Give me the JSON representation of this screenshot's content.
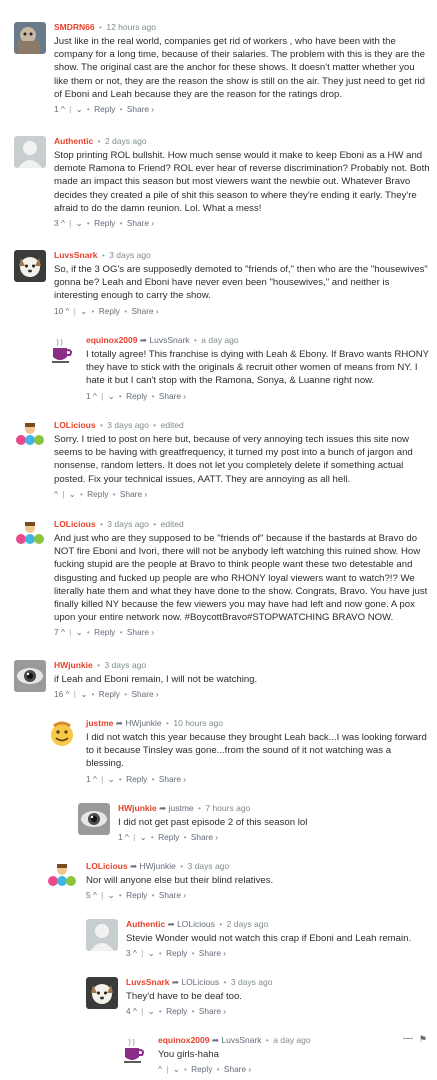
{
  "actions": {
    "reply": "Reply",
    "share": "Share ›",
    "upvote": "^",
    "downvote": "⌄",
    "sep": "|",
    "dot": "•",
    "reply_arrow": "➦",
    "collapse": "—",
    "flag": "⚑"
  },
  "comments": [
    {
      "author": "SMDRN66",
      "meta": "12 hours ago",
      "text": "Just like in the real world, companies get rid of workers , who have been with the company for a long time, because of their salaries. The problem with this is they are the show. The original cast are the anchor for these shows. It doesn't matter whether you like them or not, they are the reason the show is still on the air. They just need to get rid of Eboni and Leah because they are the reason for the ratings drop.",
      "votes": "1"
    },
    {
      "author": "Authentic",
      "meta": "2 days ago",
      "text": "Stop printing ROL bullshit. How much sense would it make to keep Eboni as a HW and demote Ramona to Friend? ROL ever hear of reverse discrimination? Probably not. Both made an impact this season but most viewers want the newbie out. Whatever Bravo decides they created a pile of shit this season to where they're ending it early. They're afraid to do the damn reunion. Lol. What a mess!",
      "votes": "3"
    },
    {
      "author": "LuvsSnark",
      "meta": "3 days ago",
      "text": "So, if the 3 OG's are supposedly demoted to \"friends of,\" then who are the \"housewives\" gonna be? Leah and Eboni have never even been \"housewives,\" and neither is interesting enough to carry the show.",
      "votes": "10"
    },
    {
      "author": "equinox2009",
      "parent": "LuvsSnark",
      "meta": "a day ago",
      "text": "I totally agree! This franchise is dying with Leah & Ebony. If Bravo wants RHONY they have to stick with the originals & recruit other women of means from NY. I hate it but I can't stop with the Ramona, Sonya, & Luanne right now.",
      "votes": "1"
    },
    {
      "author": "LOLicious",
      "meta": "3 days ago",
      "edited": "edited",
      "text": "Sorry. I tried to post on here but, because of very annoying tech issues this site now seems to be having with greatfrequency, it turned my post into a bunch of jargon and nonsense, random letters. It does not let you completely delete if something actual posted. Fix your technical issues, AATT. They are annoying as all hell.",
      "votes": ""
    },
    {
      "author": "LOLicious",
      "meta": "3 days ago",
      "edited": "edited",
      "text": "And just who are they supposed to be \"friends of\" because if the bastards at Bravo do NOT fire Eboni and Ivori, there will not be anybody left watching this ruined show. How fucking stupid are the people at Bravo to think people want these two detestable and disgusting and fucked up people are who RHONY loyal viewers want to watch?!? We literally hate them and what they have done to the show. Congrats, Bravo. You have just finally killed NY because the few viewers you may have had left and now gone. A pox upon your entire network now. #BoycottBravo#STOPWATCHING BRAVO NOW.",
      "votes": "7"
    },
    {
      "author": "HWjunkie",
      "meta": "3 days ago",
      "text": "if Leah and Eboni remain, I will not be watching.",
      "votes": "16"
    },
    {
      "author": "justme",
      "parent": "HWjunkie",
      "meta": "10 hours ago",
      "text": "I did not watch this year because they brought Leah back...I was looking forward to it because Tinsley was gone...from the sound of it not watching was a blessing.",
      "votes": "1"
    },
    {
      "author": "HWjunkie",
      "parent": "justme",
      "meta": "7 hours ago",
      "text": "I did not get past episode 2 of this season lol",
      "votes": "1"
    },
    {
      "author": "LOLicious",
      "parent": "HWjunkie",
      "meta": "3 days ago",
      "text": "Nor will anyone else but their blind relatives.",
      "votes": "5"
    },
    {
      "author": "Authentic",
      "parent": "LOLicious",
      "meta": "2 days ago",
      "text": "Stevie Wonder would not watch this crap if Eboni and Leah remain.",
      "votes": "3"
    },
    {
      "author": "LuvsSnark",
      "parent": "LOLicious",
      "meta": "3 days ago",
      "text": "They'd have to be deaf too.",
      "votes": "4"
    },
    {
      "author": "equinox2009",
      "parent": "LuvsSnark",
      "meta": "a day ago",
      "text": "You girls-haha",
      "votes": ""
    }
  ]
}
